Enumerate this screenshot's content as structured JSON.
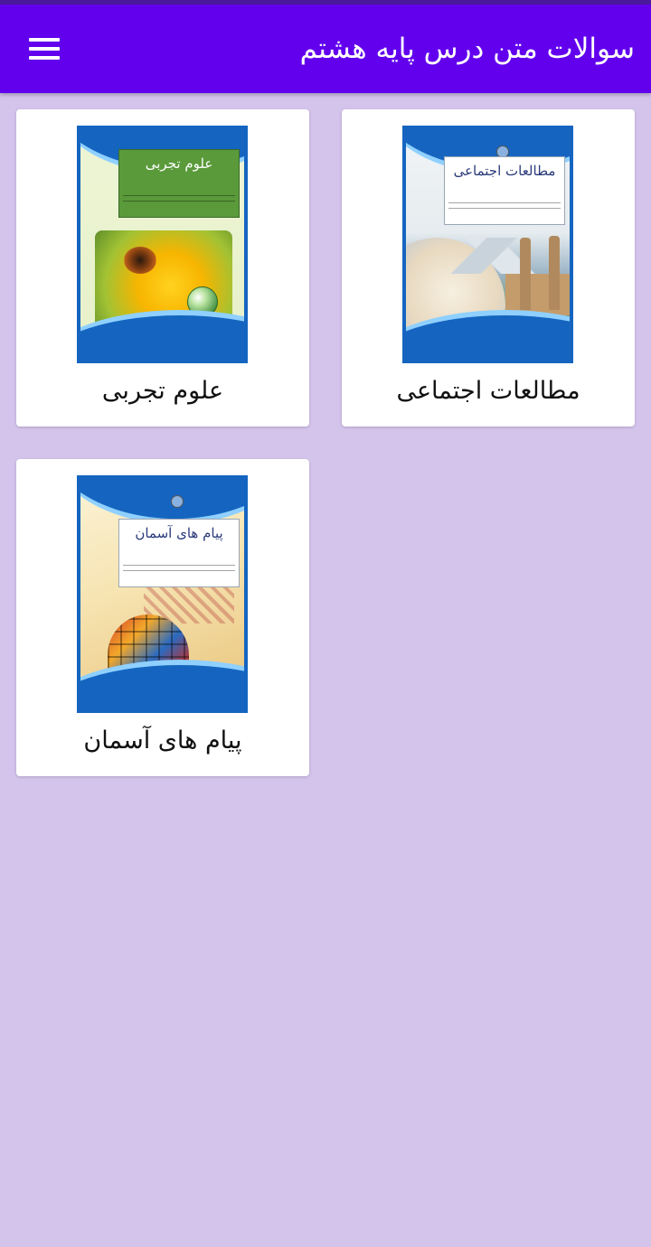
{
  "app": {
    "title": "سوالات متن درس پایه هشتم",
    "menu_icon": "hamburger-menu-icon"
  },
  "colors": {
    "status_bar": "#4b1a9c",
    "app_bar": "#6200ee",
    "background": "#d4c4ec",
    "card": "#ffffff",
    "cover_frame": "#1565c0"
  },
  "books": [
    {
      "label": "مطالعات اجتماعی",
      "cover_title": "مطالعات اجتماعی"
    },
    {
      "label": "علوم تجربی",
      "cover_title": "علوم تجربی"
    },
    {
      "label": "پیام های آسمان",
      "cover_title": "پیام های آسمان"
    }
  ]
}
